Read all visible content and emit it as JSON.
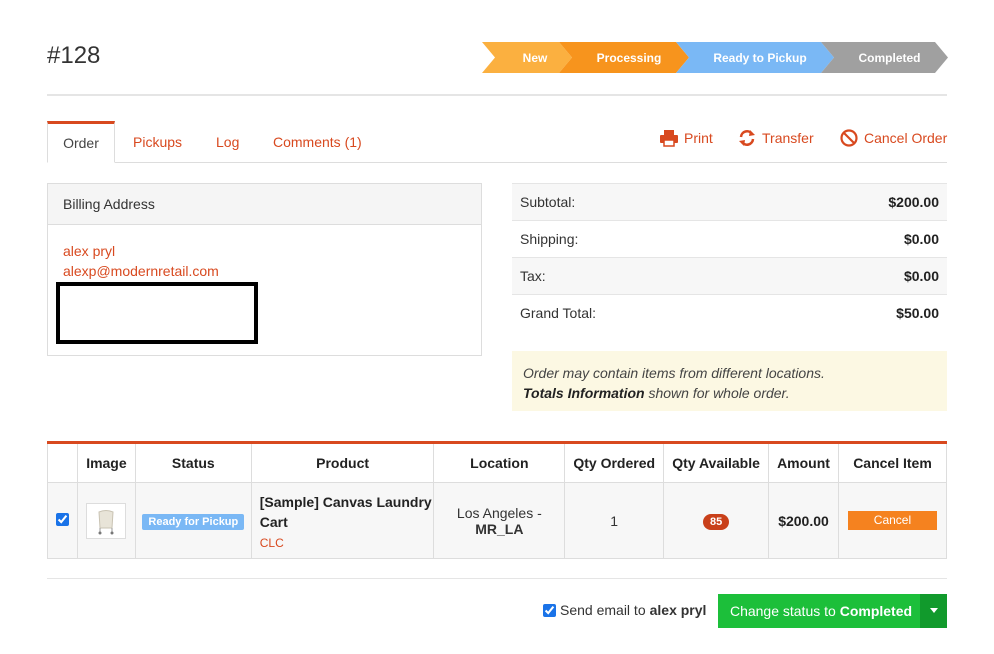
{
  "order": {
    "title": "#128"
  },
  "steps": [
    {
      "label": "New",
      "color": "#fbb040"
    },
    {
      "label": "Processing",
      "color": "#f7941d"
    },
    {
      "label": "Ready to Pickup",
      "color": "#7ab8f5"
    },
    {
      "label": "Completed",
      "color": "#a0a0a0"
    }
  ],
  "tabs": [
    {
      "label": "Order"
    },
    {
      "label": "Pickups"
    },
    {
      "label": "Log"
    },
    {
      "label": "Comments (1)"
    }
  ],
  "actions": {
    "print": "Print",
    "transfer": "Transfer",
    "cancel_order": "Cancel Order"
  },
  "billing": {
    "heading": "Billing Address",
    "name": "alex pryl",
    "email": "alexp@modernretail.com"
  },
  "totals": [
    {
      "label": "Subtotal:",
      "value": "$200.00"
    },
    {
      "label": "Shipping:",
      "value": "$0.00"
    },
    {
      "label": "Tax:",
      "value": "$0.00"
    },
    {
      "label": "Grand Total:",
      "value": "$50.00"
    }
  ],
  "note": {
    "line1": "Order may contain items from different locations.",
    "line2_bold": "Totals Information",
    "line2_rest": " shown for whole order."
  },
  "table": {
    "headers": [
      "Image",
      "Status",
      "Product",
      "Location",
      "Qty Ordered",
      "Qty Available",
      "Amount",
      "Cancel Item"
    ],
    "row": {
      "checked": true,
      "status": "Ready for Pickup",
      "product_name": "[Sample] Canvas Laundry Cart",
      "sku": "CLC",
      "location_line1": "Los Angeles -",
      "location_line2": "MR_LA",
      "qty_ordered": "1",
      "qty_available": "85",
      "amount": "$200.00",
      "cancel_label": "Cancel"
    }
  },
  "footer": {
    "send_email_prefix": "Send email to ",
    "send_email_name": "alex pryl",
    "send_email_checked": true,
    "status_prefix": "Change status to ",
    "status_target": "Completed"
  },
  "colors": {
    "accent": "#d8491f",
    "success": "#1cbf3a",
    "success_dark": "#119a2c"
  }
}
